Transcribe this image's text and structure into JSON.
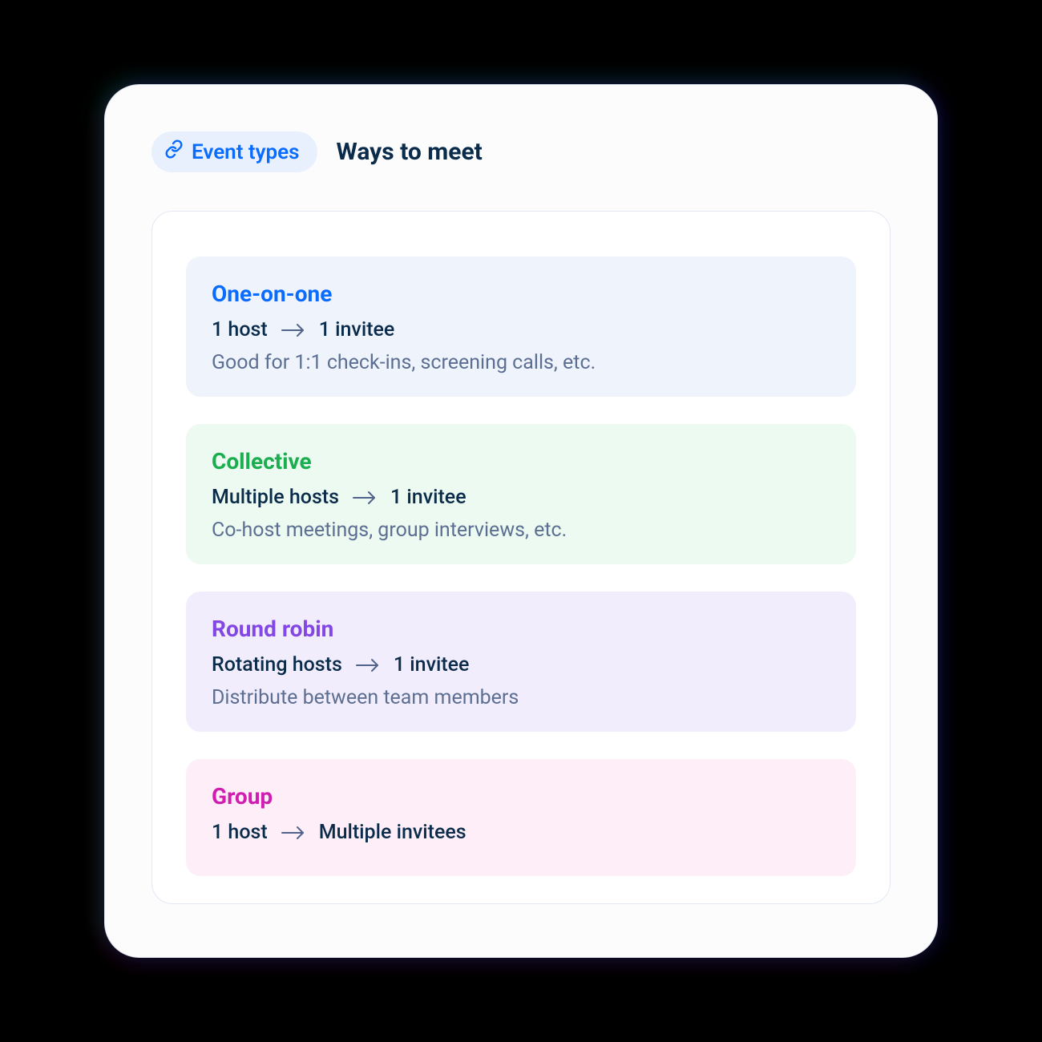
{
  "header": {
    "badge_label": "Event types",
    "title": "Ways to meet"
  },
  "cards": [
    {
      "key": "one",
      "title": "One-on-one",
      "hosts": "1 host",
      "invitees": "1 invitee",
      "desc": "Good for 1:1 check-ins, screening calls, etc."
    },
    {
      "key": "coll",
      "title": "Collective",
      "hosts": "Multiple hosts",
      "invitees": "1 invitee",
      "desc": "Co-host meetings, group interviews, etc."
    },
    {
      "key": "rr",
      "title": "Round robin",
      "hosts": "Rotating hosts",
      "invitees": "1 invitee",
      "desc": "Distribute between team members"
    },
    {
      "key": "grp",
      "title": "Group",
      "hosts": "1 host",
      "invitees": "Multiple invitees",
      "desc": ""
    }
  ]
}
